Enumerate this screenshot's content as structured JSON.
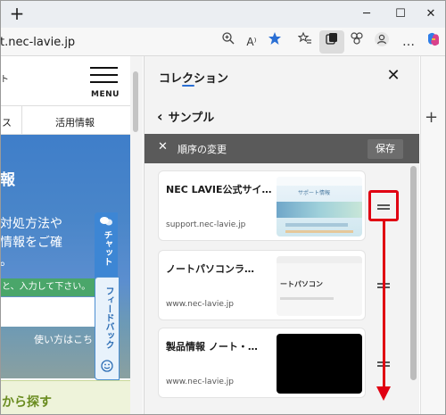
{
  "browser": {
    "new_tab": "+",
    "window_controls": {
      "minimize": "─",
      "maximize": "☐",
      "close": "✕"
    },
    "address": "t.nec-lavie.jp",
    "toolbar_icons": [
      "zoom-icon",
      "read-aloud-icon",
      "favorite-star-icon",
      "favorites-list-icon",
      "collections-icon",
      "extensions-icon",
      "profile-icon",
      "more-menu-icon",
      "copilot-icon"
    ],
    "read_aloud_label": "A⁾",
    "more_label": "…"
  },
  "page": {
    "logo_fragment": "ト",
    "menu_label": "MENU",
    "nav": {
      "left_fragment": "ス",
      "right_item": "活用情報"
    },
    "hero": {
      "heading_fragment": "報",
      "line1": "対処方法や",
      "line2": "情報をご確",
      "line3": "。"
    },
    "search_hint": "と、入力して下さい。",
    "howto": "使い方はこちら",
    "find": "から探す",
    "chat_tab": "チャット",
    "chat_tab_extra": "ト",
    "feedback_tab": "フィードバック"
  },
  "collections": {
    "title": "コレクション",
    "close": "✕",
    "back": "‹",
    "collection_name": "サンプル",
    "reorder": {
      "close": "✕",
      "label": "順序の変更",
      "save": "保存"
    },
    "items": [
      {
        "title": "NEC LAVIE公式サイ…",
        "domain": "support.nec-lavie.jp",
        "thumb_label": "サポート情報"
      },
      {
        "title": "ノートパソコンラ…",
        "domain": "www.nec-lavie.jp",
        "thumb_label": "ートパソコン"
      },
      {
        "title": "製品情報 ノート・…",
        "domain": "www.nec-lavie.jp",
        "thumb_label": ""
      }
    ]
  },
  "sidebar": {
    "add": "+"
  },
  "colors": {
    "accent": "#2a6fd4",
    "annotation": "#e00012",
    "reorder_bar": "#5a5a5a"
  }
}
